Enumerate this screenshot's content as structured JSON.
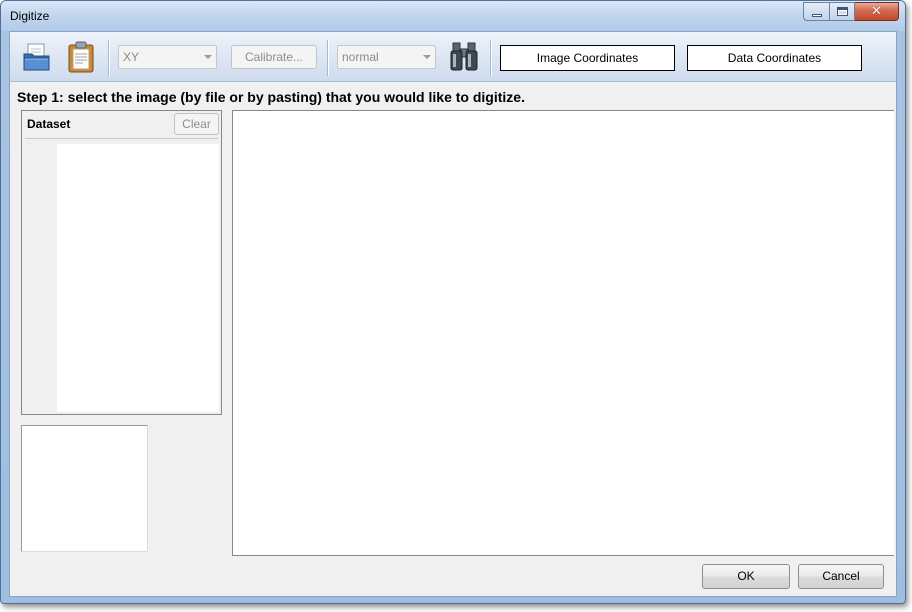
{
  "window": {
    "title": "Digitize"
  },
  "toolbar": {
    "open_icon": "folder-open-icon",
    "paste_icon": "clipboard-paste-icon",
    "coord_type": {
      "selected": "XY"
    },
    "calibrate_label": "Calibrate...",
    "mode": {
      "selected": "normal"
    },
    "find_icon": "binoculars-icon",
    "image_coordinates_label": "Image Coordinates",
    "data_coordinates_label": "Data Coordinates"
  },
  "instructions": {
    "step": "Step 1: select the image (by file or by pasting) that you would like to digitize."
  },
  "dataset": {
    "title": "Dataset",
    "clear_label": "Clear"
  },
  "footer": {
    "ok_label": "OK",
    "cancel_label": "Cancel"
  },
  "colors": {
    "title_bar": "#c3d7ee",
    "client_bg": "#f0f0f0",
    "close_button": "#c14a2c",
    "frame_border": "#4e6f96"
  }
}
